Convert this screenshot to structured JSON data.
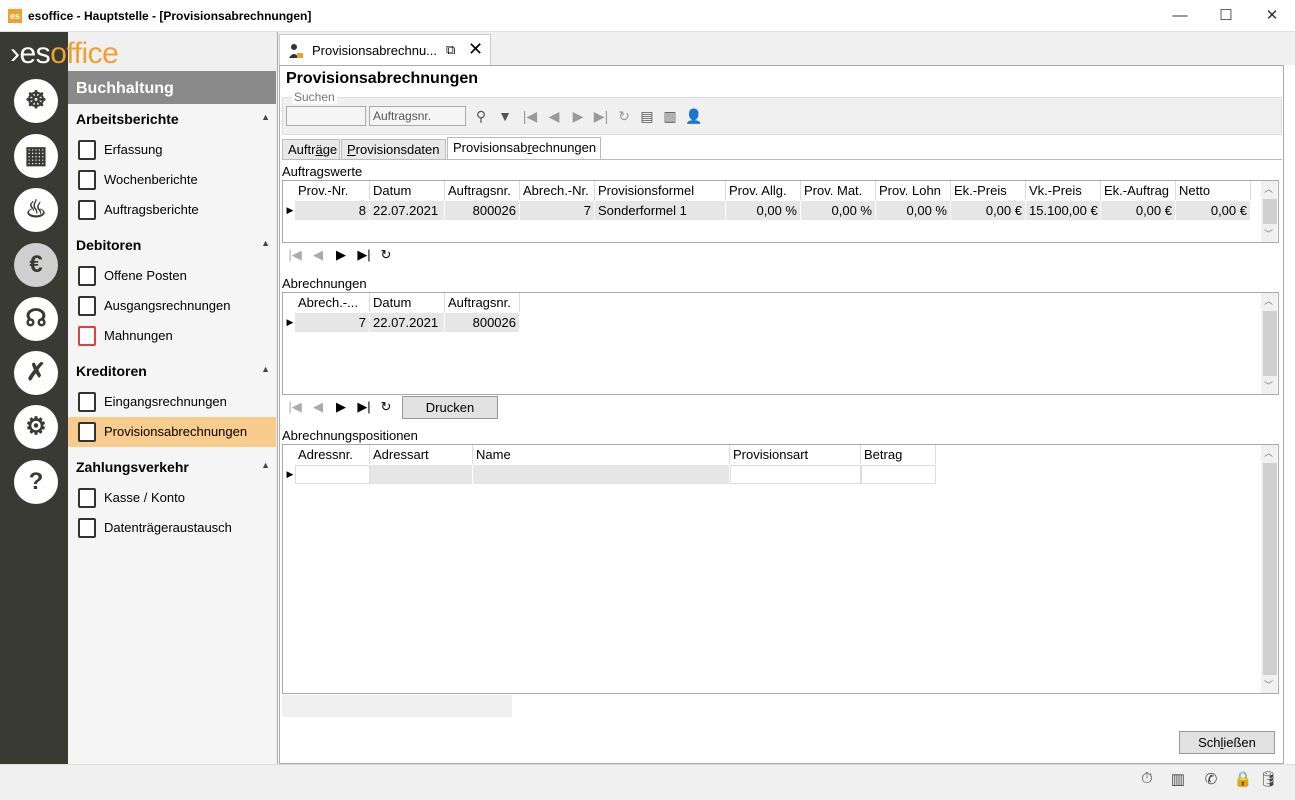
{
  "window": {
    "title": "esoffice - Hauptstelle - [Provisionsabrechnungen]",
    "app_icon": "esoffice-app-icon",
    "minimize": "—",
    "maximize": "☐",
    "close": "✕"
  },
  "logo": {
    "prefix": "›es",
    "suffix": "office"
  },
  "rail": [
    {
      "icon": "ship-wheel-icon",
      "glyph": "☸"
    },
    {
      "icon": "planner-icon",
      "glyph": "▦"
    },
    {
      "icon": "siren-icon",
      "glyph": "♨"
    },
    {
      "icon": "money-icon",
      "glyph": "€"
    },
    {
      "icon": "headset-icon",
      "glyph": "☊"
    },
    {
      "icon": "tools-icon",
      "glyph": "✗"
    },
    {
      "icon": "gears-icon",
      "glyph": "⚙"
    },
    {
      "icon": "help-icon",
      "glyph": "?"
    }
  ],
  "nav": {
    "header": "Buchhaltung",
    "sections": [
      {
        "title": "Arbeitsberichte",
        "items": [
          "Erfassung",
          "Wochenberichte",
          "Auftragsberichte"
        ]
      },
      {
        "title": "Debitoren",
        "items": [
          "Offene Posten",
          "Ausgangsrechnungen",
          "Mahnungen"
        ]
      },
      {
        "title": "Kreditoren",
        "items": [
          "Eingangsrechnungen",
          "Provisionsabrechnungen"
        ]
      },
      {
        "title": "Zahlungsverkehr",
        "items": [
          "Kasse / Konto",
          "Datenträgeraustausch"
        ]
      }
    ],
    "active_item": "Provisionsabrechnungen"
  },
  "doc_tab": {
    "label": "Provisionsabrechnu...",
    "popout": "⧉",
    "close": "✕"
  },
  "page_title": "Provisionsabrechnungen",
  "search": {
    "legend": "Suchen",
    "field_value": "Auftragsnr.",
    "toolbar": [
      "⚲",
      "▼",
      "|◀",
      "◀",
      "▶",
      "▶|",
      "↻",
      "▤",
      "▥",
      "👤"
    ]
  },
  "inner_tabs": [
    {
      "pre": "Auftr",
      "u": "ä",
      "post": "ge"
    },
    {
      "pre": "",
      "u": "P",
      "post": "rovisionsdaten"
    },
    {
      "pre": "Provisionsab",
      "u": "r",
      "post": "echnungen"
    }
  ],
  "auftragswerte": {
    "label": "Auftragswerte",
    "columns": [
      "Prov.-Nr.",
      "Datum",
      "Auftragsnr.",
      "Abrech.-Nr.",
      "Provisionsformel",
      "Prov. Allg.",
      "Prov. Mat.",
      "Prov. Lohn",
      "Ek.-Preis",
      "Vk.-Preis",
      "Ek.-Auftrag",
      "Netto"
    ],
    "rows": [
      [
        "8",
        "22.07.2021",
        "800026",
        "7",
        "Sonderformel 1",
        "0,00 %",
        "0,00 %",
        "0,00 %",
        "0,00 €",
        "15.100,00 €",
        "0,00 €",
        "0,00 €"
      ]
    ]
  },
  "abrechnungen": {
    "label": "Abrechnungen",
    "columns": [
      "Abrech.-...",
      "Datum",
      "Auftragsnr."
    ],
    "rows": [
      [
        "7",
        "22.07.2021",
        "800026"
      ]
    ]
  },
  "positionen": {
    "label": "Abrechnungspositionen",
    "columns": [
      "Adressnr.",
      "Adressart",
      "Name",
      "Provisionsart",
      "Betrag"
    ]
  },
  "navbar": [
    "|◀",
    "◀",
    "▶",
    "▶|",
    "↻"
  ],
  "print_button": {
    "label": "Drucken"
  },
  "close_button": {
    "pre": "Sch",
    "u": "l",
    "post": "ießen"
  },
  "statusbar": [
    "⏱",
    "▥",
    "✆",
    "🔒",
    "🛢"
  ]
}
